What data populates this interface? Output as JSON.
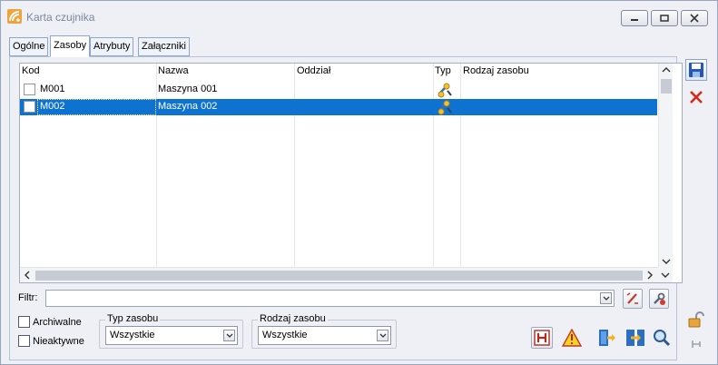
{
  "window": {
    "title": "Karta czujnika"
  },
  "tabs": [
    {
      "label": "Ogólne"
    },
    {
      "label": "Zasoby"
    },
    {
      "label": "Atrybuty"
    },
    {
      "label": "Załączniki"
    }
  ],
  "grid": {
    "columns": [
      "Kod",
      "Nazwa",
      "Oddział",
      "Typ",
      "Rodzaj zasobu"
    ],
    "rows": [
      {
        "kod": "M001",
        "nazwa": "Maszyna 001",
        "oddzial": "",
        "typ": "machine-icon",
        "rodzaj": "",
        "selected": false
      },
      {
        "kod": "M002",
        "nazwa": "Maszyna 002",
        "oddzial": "",
        "typ": "machine-icon",
        "rodzaj": "",
        "selected": true
      }
    ]
  },
  "filter": {
    "label": "Filtr:",
    "value": ""
  },
  "options": {
    "archiwalne": {
      "label": "Archiwalne",
      "checked": false
    },
    "nieaktywne": {
      "label": "Nieaktywne",
      "checked": false
    }
  },
  "typ_zasobu": {
    "title": "Typ zasobu",
    "value": "Wszystkie"
  },
  "rodzaj_zasobu": {
    "title": "Rodzaj zasobu",
    "value": "Wszystkie"
  },
  "colors": {
    "selection": "#0e72d0",
    "delete_red": "#d42a1e",
    "save_blue": "#2457b8"
  }
}
